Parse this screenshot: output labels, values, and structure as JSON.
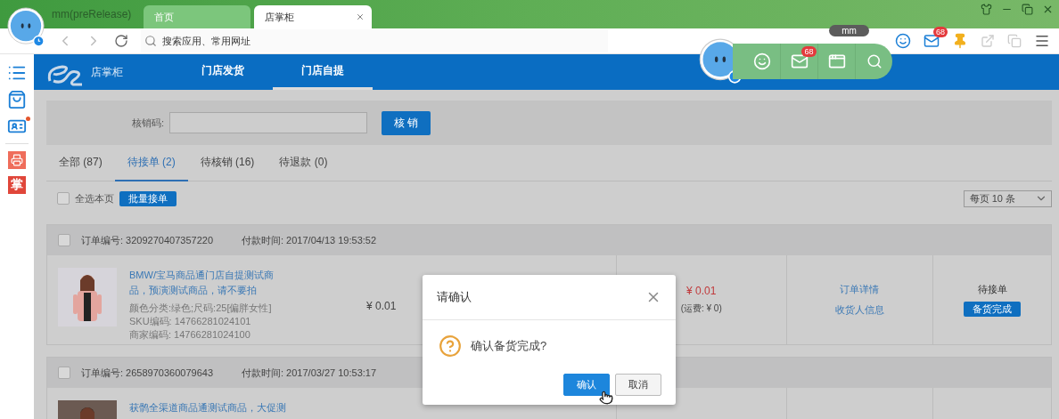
{
  "browser": {
    "profile": "mm(preRelease)",
    "tabs": [
      {
        "label": "首页",
        "selected": false
      },
      {
        "label": "店掌柜",
        "selected": true
      }
    ],
    "address_placeholder": "搜索应用、常用网址",
    "mail_badge": "68"
  },
  "widget": {
    "tooltip": "mm",
    "mail_badge": "68"
  },
  "sidebar": {
    "items": [
      {
        "kind": "menu",
        "unread": false
      },
      {
        "kind": "bag",
        "unread": false
      },
      {
        "kind": "card",
        "unread": true
      },
      {
        "kind": "printer",
        "unread": false
      },
      {
        "kind": "text",
        "label": "掌",
        "unread": false
      }
    ]
  },
  "header": {
    "brand": "店掌柜",
    "nav": [
      {
        "label": "门店发货",
        "selected": false
      },
      {
        "label": "门店自提",
        "selected": true
      }
    ]
  },
  "verify": {
    "label": "核销码:",
    "button": "核 销"
  },
  "status_tabs": [
    {
      "label": "全部 (87)",
      "selected": false
    },
    {
      "label": "待接单 (2)",
      "selected": true
    },
    {
      "label": "待核销 (16)",
      "selected": false
    },
    {
      "label": "待退款 (0)",
      "selected": false
    }
  ],
  "select_all": {
    "label": "全选本页",
    "checked": false
  },
  "batch_button": "批量接单",
  "page_size": "每页 10 条",
  "orders": [
    {
      "checked": false,
      "order_no": "订单编号: 3209270407357220",
      "paid_at": "付款时间: 2017/04/13 19:53:52",
      "title_lines": [
        "BMW/宝马商品通门店自提测试商",
        "品，预演测试商品，请不要拍"
      ],
      "attributes": [
        "颜色分类:绿色;尺码:25[偏胖女性]",
        "SKU编码: 14766281024101",
        "商家编码: 14766281024100"
      ],
      "unit_price": "¥ 0.01",
      "total": "¥ 0.01",
      "shipping": "(运费: ¥ 0)",
      "links": [
        "订单详情",
        "收货人信息"
      ],
      "status": "待接单",
      "action": "备货完成"
    },
    {
      "checked": false,
      "order_no": "订单编号: 2658970360079643",
      "paid_at": "付款时间: 2017/03/27 10:53:17",
      "title_lines": [
        "获鹘全渠道商品通测试商品，大促测"
      ]
    }
  ],
  "dialog": {
    "title": "请确认",
    "message": "确认备货完成?",
    "confirm": "确认",
    "cancel": "取消"
  }
}
